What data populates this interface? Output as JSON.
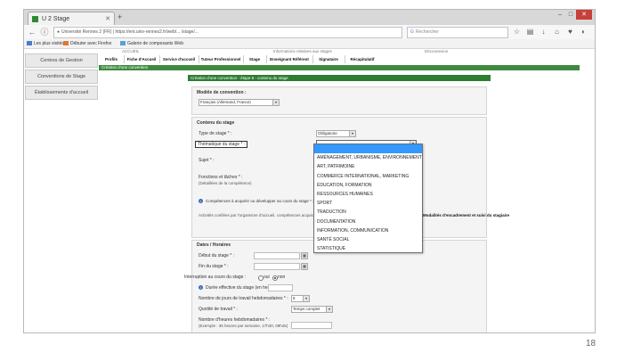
{
  "browser": {
    "tab_title": "U 2 Stage",
    "url": "Université Rennes 2 (FR) | https://ent.univ-rennes2.fr/web/... /stage/...",
    "search_placeholder": "Rechercher",
    "bookmarks": [
      "Les plus visités",
      "Débuter avec Firefox",
      "Galerie de composants Web"
    ],
    "colors": {
      "tab_favicon": "#2f8a2f",
      "close_button": "#c8403a"
    }
  },
  "top_info": {
    "left": "ACCUEIL",
    "middle": "Informations relatives aux stages",
    "right": "Déconnexion"
  },
  "sidebar": {
    "items": [
      {
        "label": "Centres de Gestion"
      },
      {
        "label": "Conventions de Stage"
      },
      {
        "label": "Établissements d'accueil"
      }
    ]
  },
  "menu": {
    "items": [
      "Profils",
      "Fiche d'Accueil",
      "Service d'accueil",
      "Tuteur Professionnel",
      "Stage",
      "Enseignant Référent",
      "Signataire",
      "Récapitulatif"
    ]
  },
  "banners": {
    "main": "Création d'une convention",
    "step": "Création d'une convention - étape 6 - contenu du stage",
    "colors": {
      "menu_bar": "#3f8a3f",
      "step_bar": "#2e7d32"
    }
  },
  "model_section": {
    "title": "Modèle de convention :",
    "value": "Français (Allemand, France)"
  },
  "content_section": {
    "title": "Contenu du stage",
    "type_label": "Type de stage * :",
    "type_value": "Obligatoire",
    "theme_label": "Thématique du stage * :",
    "subject_label": "Sujet * :",
    "functions_label": "Fonctions et tâches * :",
    "functions_hint": "(Détaillées de la compétence)",
    "info_text": "Compétences à acquérir ou développer au cours du stage * :",
    "info_extra": "Activités confiées par l'organisme d'accueil, compétences acquises ou développées",
    "info_right": "Modalités d'encadrement et suivi du stagiaire"
  },
  "theme_dropdown": {
    "items": [
      "",
      "AMÉNAGEMENT, URBANISME, ENVIRONNEMENT",
      "ART, PATRIMOINE",
      "COMMERCE INTERNATIONAL, MARKETING",
      "ÉDUCATION, FORMATION",
      "RESSOURCES HUMAINES",
      "SPORT",
      "TRADUCTION",
      "DOCUMENTATION",
      "INFORMATION, COMMUNICATION",
      "SANTÉ SOCIAL",
      "STATISTIQUE"
    ],
    "selected_index": 0
  },
  "dates_section": {
    "title": "Dates / Horaires",
    "start_label": "Début du stage * :",
    "end_label": "Fin du stage * :",
    "interruption_label": "Interruption au cours du stage :",
    "radio_yes": "oui",
    "radio_no": "non",
    "duration_label": "Durée effective du stage (en heures) :",
    "days_label": "Nombre de jours de travail hebdomadaires * :",
    "days_value": "5",
    "schedule_label": "Quotité de travail * :",
    "schedule_value": "Temps complet",
    "weekly_label": "Nombre d'heures hebdomadaires * :",
    "weekly_hint": "(Exemple : 35 heures par semaine, 17h30, 09h45)"
  },
  "slide": {
    "page_number": "18"
  }
}
